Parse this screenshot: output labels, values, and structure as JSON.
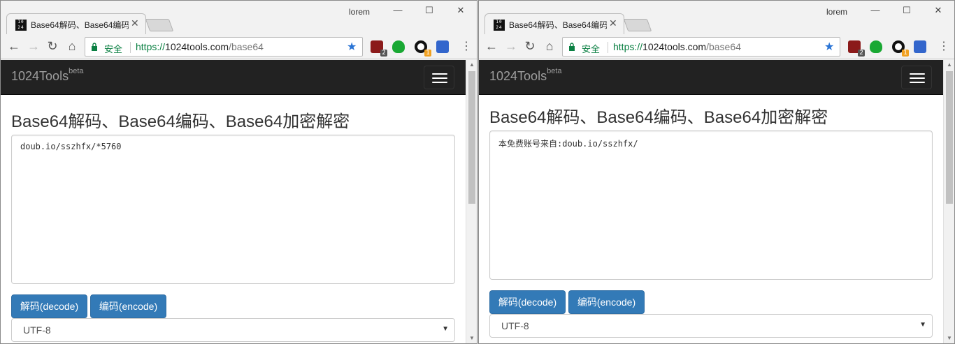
{
  "windows": [
    {
      "tab": {
        "favicon_text": "10 24",
        "title": "Base64解码、Base64编码",
        "close": "✕"
      },
      "profile": "lorem",
      "controls": {
        "minimize": "—",
        "maximize": "☐",
        "close": "✕"
      },
      "toolbar": {
        "back": "←",
        "forward": "→",
        "reload": "↻",
        "home": "⌂",
        "menu": "⋮"
      },
      "omnibox": {
        "secure_label": "安全",
        "scheme": "https://",
        "host": "1024tools.com",
        "path": "/base64"
      },
      "extensions": [
        {
          "name": "ublock-icon",
          "color": "#8b1a1a",
          "badge": "2",
          "badge_color": "#555555"
        },
        {
          "name": "shield-green-icon",
          "color": "#19a833",
          "badge": "",
          "badge_color": ""
        },
        {
          "name": "circle-ext-icon",
          "color": "#111111",
          "badge": "1",
          "badge_color": "#f0a020"
        },
        {
          "name": "save-ext-icon",
          "color": "#3366cc",
          "badge": "",
          "badge_color": ""
        }
      ],
      "site": {
        "brand": "1024Tools",
        "brand_sup": "beta",
        "heading": "Base64解码、Base64编码、Base64加密解密",
        "textarea_value": "doub.io/sszhfx/*5760",
        "decode_label": "解码(decode)",
        "encode_label": "编码(encode)",
        "charset": "UTF-8"
      }
    },
    {
      "tab": {
        "favicon_text": "10 24",
        "title": "Base64解码、Base64编码",
        "close": "✕"
      },
      "profile": "lorem",
      "controls": {
        "minimize": "—",
        "maximize": "☐",
        "close": "✕"
      },
      "toolbar": {
        "back": "←",
        "forward": "→",
        "reload": "↻",
        "home": "⌂",
        "menu": "⋮"
      },
      "omnibox": {
        "secure_label": "安全",
        "scheme": "https://",
        "host": "1024tools.com",
        "path": "/base64"
      },
      "extensions": [
        {
          "name": "ublock-icon",
          "color": "#8b1a1a",
          "badge": "2",
          "badge_color": "#555555"
        },
        {
          "name": "shield-green-icon",
          "color": "#19a833",
          "badge": "",
          "badge_color": ""
        },
        {
          "name": "circle-ext-icon",
          "color": "#111111",
          "badge": "1",
          "badge_color": "#f0a020"
        },
        {
          "name": "save-ext-icon",
          "color": "#3366cc",
          "badge": "",
          "badge_color": ""
        }
      ],
      "site": {
        "brand": "1024Tools",
        "brand_sup": "beta",
        "heading": "Base64解码、Base64编码、Base64加密解密",
        "textarea_value": "本免费账号来自:doub.io/sszhfx/",
        "decode_label": "解码(decode)",
        "encode_label": "编码(encode)",
        "charset": "UTF-8"
      }
    }
  ],
  "colors": {
    "navbar": "#222222",
    "button_primary": "#337ab7",
    "secure_green": "#0b8043",
    "star_blue": "#2a74d5"
  }
}
